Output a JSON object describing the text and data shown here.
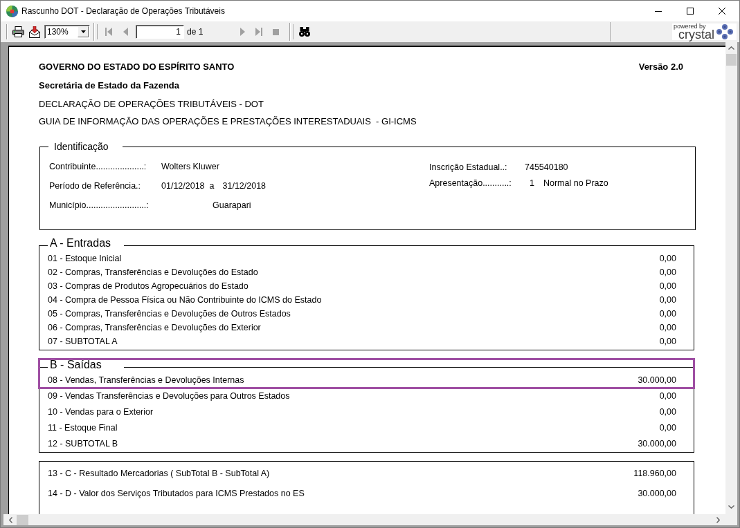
{
  "window": {
    "title": "Rascunho DOT - Declaração de Operações Tributáveis"
  },
  "toolbar": {
    "zoom": "130%",
    "page": "1",
    "page_count": "de 1",
    "nav_buttons": [
      {
        "kind": "first",
        "disabled": true
      },
      {
        "kind": "previous",
        "disabled": true
      },
      {
        "kind": "next",
        "disabled": true
      },
      {
        "kind": "last",
        "disabled": true
      },
      {
        "kind": "stop",
        "disabled": true
      }
    ],
    "logo": {
      "tagline": "powered by",
      "name": "crystal"
    }
  },
  "report": {
    "header": {
      "organization": "GOVERNO DO ESTADO DO ESPÍRITO SANTO",
      "version": "Versão 2.0",
      "department": "Secretária de Estado da Fazenda",
      "lines": [
        "DECLARAÇÃO DE OPERAÇÕES TRIBUTÁVEIS - DOT",
        "GUIA DE INFORMAÇÃO DAS OPERAÇÕES E PRESTAÇÕES INTERESTADUAIS  - GI-ICMS"
      ]
    },
    "identification": {
      "title": "Identificação",
      "left_fields": [
        {
          "label": "Contribuinte....................:",
          "value": "Wolters Kluwer"
        },
        {
          "label": "Período de Referência.:",
          "value": "01/12/2018",
          "connector": "a",
          "value_end": "31/12/2018"
        },
        {
          "label": "Município.........................:",
          "value": "Guarapari"
        }
      ],
      "right_fields": [
        {
          "label": "Inscrição Estadual..:",
          "value": "745540180"
        },
        {
          "label": "Apresentação...........:",
          "code": "1",
          "value": "Normal no Prazo"
        }
      ]
    },
    "sections": [
      {
        "title": "A - Entradas",
        "highlighted": false,
        "rows": [
          {
            "label": "01 - Estoque Inicial",
            "value": "0,00"
          },
          {
            "label": "02 - Compras, Transferências e Devoluções do Estado",
            "value": "0,00"
          },
          {
            "label": "03 - Compras de Produtos Agropecuários do Estado",
            "value": "0,00"
          },
          {
            "label": "04 - Compra de Pessoa Física ou Não Contribuinte do ICMS do Estado",
            "value": "0,00"
          },
          {
            "label": "05 - Compras, Transferências e Devoluções de Outros Estados",
            "value": "0,00"
          },
          {
            "label": "06 - Compras, Transferências e Devoluções do Exterior",
            "value": "0,00"
          },
          {
            "label": "07 - SUBTOTAL A",
            "value": "0,00"
          }
        ]
      },
      {
        "title": "B - Saídas",
        "highlighted": true,
        "rows": [
          {
            "label": "08 - Vendas, Transferências e Devoluções Internas",
            "value": "30.000,00"
          },
          {
            "label": "09 - Vendas Transferências e Devoluções para Outros Estados",
            "value": "0,00"
          },
          {
            "label": "10 - Vendas para o Exterior",
            "value": "0,00"
          },
          {
            "label": "11 - Estoque Final",
            "value": "0,00"
          },
          {
            "label": "12 - SUBTOTAL B",
            "value": "30.000,00"
          }
        ]
      },
      {
        "highlighted": false,
        "rows": [
          {
            "label": "13 - C - Resultado Mercadorias ( SubTotal B - SubTotal A)",
            "value": "118.960,00"
          },
          {
            "label": "14 - D - Valor dos Serviços Tributados para ICMS Prestados no ES",
            "value": "30.000,00"
          }
        ]
      }
    ]
  }
}
